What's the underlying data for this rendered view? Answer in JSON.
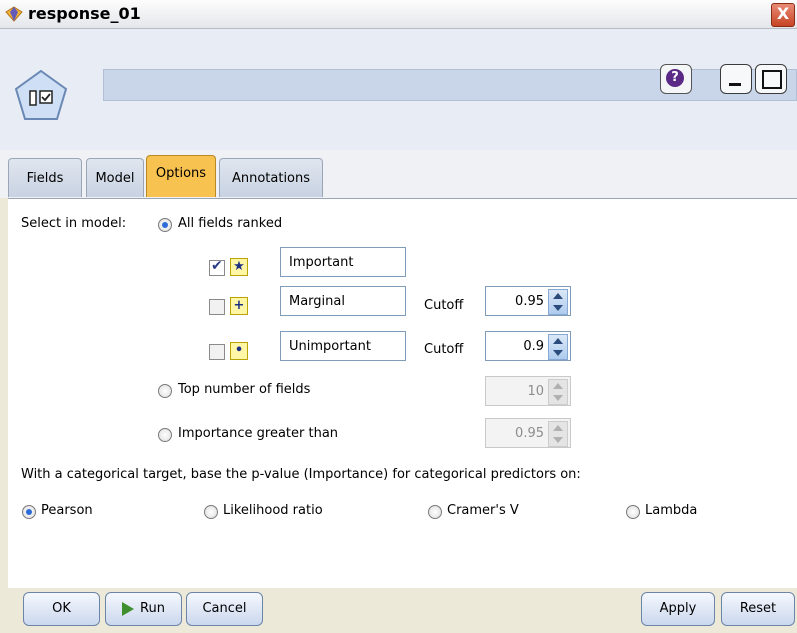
{
  "window": {
    "title": "response_01",
    "close_symbol": "X"
  },
  "header": {
    "help_symbol": "?"
  },
  "tabs": [
    {
      "label": "Fields"
    },
    {
      "label": "Model"
    },
    {
      "label": "Options",
      "active": true
    },
    {
      "label": "Annotations"
    }
  ],
  "options": {
    "select_label": "Select in model:",
    "all_ranked": "All fields ranked",
    "ranks": {
      "important": {
        "value": "Important",
        "checked": true
      },
      "marginal": {
        "value": "Marginal",
        "checked": false,
        "cutoff_label": "Cutoff",
        "cutoff": "0.95"
      },
      "unimportant": {
        "value": "Unimportant",
        "checked": false,
        "cutoff_label": "Cutoff",
        "cutoff": "0.9"
      }
    },
    "top_number": {
      "label": "Top number of fields",
      "value": "10"
    },
    "importance_gt": {
      "label": "Importance greater than",
      "value": "0.95"
    },
    "categorical_text": "With a categorical target, base the p-value (Importance) for categorical predictors on:",
    "methods": [
      "Pearson",
      "Likelihood ratio",
      "Cramer's V",
      "Lambda"
    ]
  },
  "footer": {
    "ok": "OK",
    "run": "Run",
    "cancel": "Cancel",
    "apply": "Apply",
    "reset": "Reset"
  },
  "colors": {
    "active_tab": "#f7c24f",
    "radio_selected": "#2d6bd8"
  }
}
